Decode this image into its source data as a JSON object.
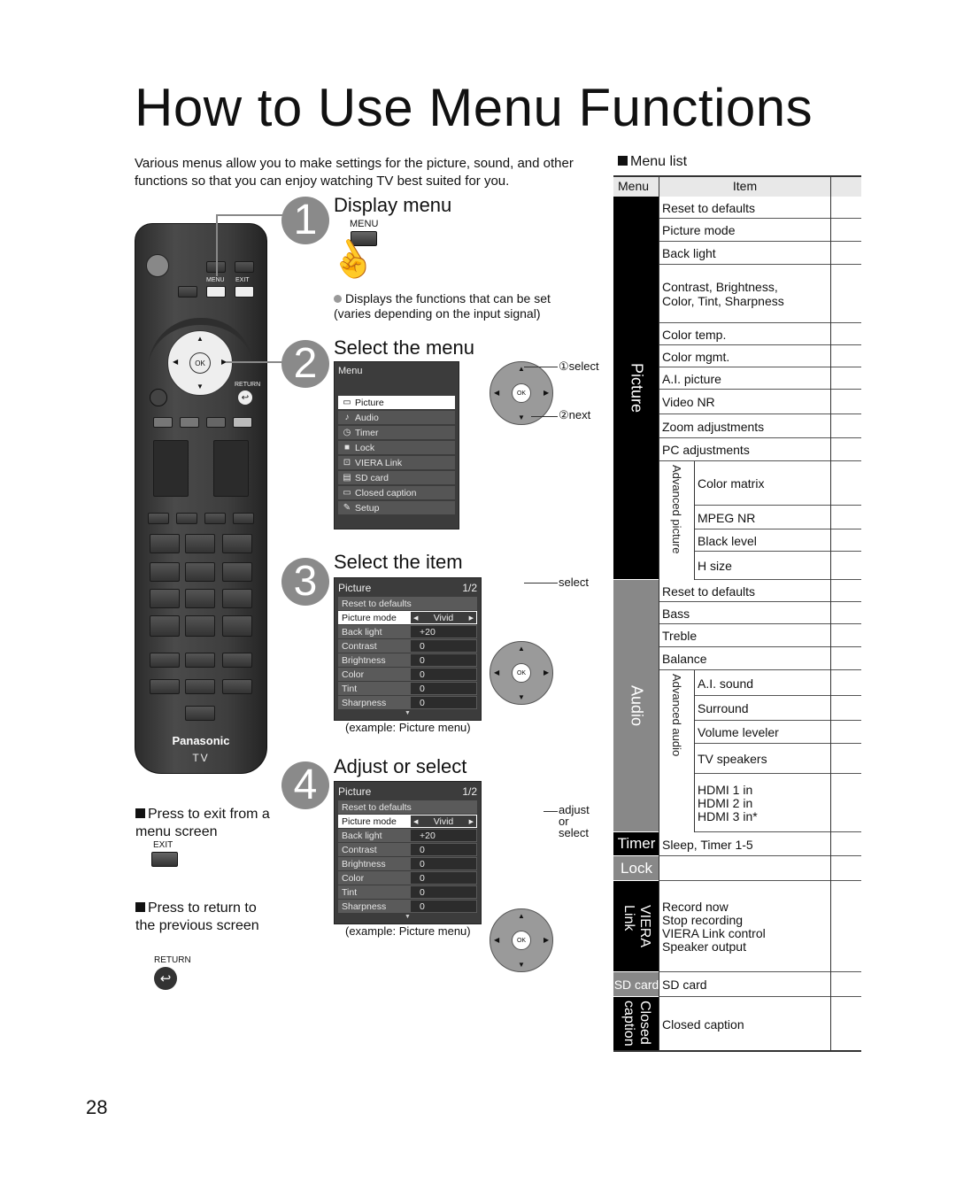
{
  "page": {
    "title": "How to Use Menu Functions",
    "intro": "Various menus allow you to make settings for the picture, sound, and other functions so that you can enjoy watching TV best suited for you.",
    "page_number": "28"
  },
  "remote": {
    "brand": "Panasonic",
    "model": "TV",
    "menu_label": "MENU",
    "exit_label": "EXIT",
    "return_label": "RETURN",
    "ok_label": "OK"
  },
  "steps": [
    {
      "number": "1",
      "title": "Display menu",
      "button_label": "MENU",
      "note": "Displays the functions that can be set (varies depending on the input signal)"
    },
    {
      "number": "2",
      "title": "Select the menu",
      "osd_title": "Menu",
      "menu_items": [
        {
          "icon": "picture-icon",
          "glyph": "▭",
          "label": "Picture",
          "selected": true
        },
        {
          "icon": "audio-icon",
          "glyph": "♪",
          "label": "Audio"
        },
        {
          "icon": "timer-icon",
          "glyph": "◷",
          "label": "Timer"
        },
        {
          "icon": "lock-icon",
          "glyph": "■",
          "label": "Lock"
        },
        {
          "icon": "viera-link-icon",
          "glyph": "⊡",
          "label": "VIERA Link"
        },
        {
          "icon": "sd-card-icon",
          "glyph": "▤",
          "label": "SD card"
        },
        {
          "icon": "closed-caption-icon",
          "glyph": "▭",
          "label": "Closed caption"
        },
        {
          "icon": "setup-icon",
          "glyph": "✎",
          "label": "Setup"
        }
      ],
      "callout_1": "①select",
      "callout_2": "②next"
    },
    {
      "number": "3",
      "title": "Select the item",
      "callout": "select",
      "caption": "(example:  Picture menu)"
    },
    {
      "number": "4",
      "title": "Adjust or select",
      "callout": "adjust\nor\nselect",
      "callout_lines": [
        "adjust",
        "or",
        "select"
      ],
      "caption": "(example:  Picture menu)"
    }
  ],
  "picture_osd": {
    "title": "Picture",
    "page": "1/2",
    "rows": [
      {
        "label": "Reset to defaults",
        "value": ""
      },
      {
        "label": "Picture mode",
        "value": "Vivid",
        "selected": true
      },
      {
        "label": "Back light",
        "value": "+20"
      },
      {
        "label": "Contrast",
        "value": "0"
      },
      {
        "label": "Brightness",
        "value": "0"
      },
      {
        "label": "Color",
        "value": "0"
      },
      {
        "label": "Tint",
        "value": "0"
      },
      {
        "label": "Sharpness",
        "value": "0"
      }
    ]
  },
  "notes": {
    "exit_note": "Press to exit from a menu screen",
    "exit_button": "EXIT",
    "return_note": "Press to return to the previous screen",
    "return_button": "RETURN"
  },
  "menu_list": {
    "heading": "Menu list",
    "col_menu": "Menu",
    "col_item": "Item",
    "categories": [
      {
        "name": "Picture",
        "style": "black"
      },
      {
        "name": "Audio",
        "style": "gray"
      },
      {
        "name": "Timer",
        "style": "black"
      },
      {
        "name": "Lock",
        "style": "gray"
      },
      {
        "name": "VIERA Link",
        "style": "black"
      },
      {
        "name": "SD card",
        "style": "gray"
      },
      {
        "name": "Closed caption",
        "style": "black"
      }
    ],
    "subgroups": [
      {
        "name": "Advanced picture",
        "category": "Picture"
      },
      {
        "name": "Advanced audio",
        "category": "Audio"
      }
    ],
    "rows": [
      {
        "category": "Picture",
        "item": "Reset to defaults"
      },
      {
        "category": "Picture",
        "item": "Picture mode"
      },
      {
        "category": "Picture",
        "item": "Back light"
      },
      {
        "category": "Picture",
        "item": "Contrast, Brightness,\nColor, Tint, Sharpness"
      },
      {
        "category": "Picture",
        "item": "Color temp."
      },
      {
        "category": "Picture",
        "item": "Color mgmt."
      },
      {
        "category": "Picture",
        "item": "A.I. picture"
      },
      {
        "category": "Picture",
        "item": "Video NR"
      },
      {
        "category": "Picture",
        "item": "Zoom adjustments"
      },
      {
        "category": "Picture",
        "item": "PC adjustments"
      },
      {
        "category": "Picture",
        "subgroup": "Advanced picture",
        "item": "Color matrix"
      },
      {
        "category": "Picture",
        "subgroup": "Advanced picture",
        "item": "MPEG NR"
      },
      {
        "category": "Picture",
        "subgroup": "Advanced picture",
        "item": "Black level"
      },
      {
        "category": "Picture",
        "subgroup": "Advanced picture",
        "item": "H size"
      },
      {
        "category": "Audio",
        "item": "Reset to defaults"
      },
      {
        "category": "Audio",
        "item": "Bass"
      },
      {
        "category": "Audio",
        "item": "Treble"
      },
      {
        "category": "Audio",
        "item": "Balance"
      },
      {
        "category": "Audio",
        "subgroup": "Advanced audio",
        "item": "A.I. sound"
      },
      {
        "category": "Audio",
        "subgroup": "Advanced audio",
        "item": "Surround"
      },
      {
        "category": "Audio",
        "subgroup": "Advanced audio",
        "item": "Volume leveler"
      },
      {
        "category": "Audio",
        "subgroup": "Advanced audio",
        "item": "TV speakers"
      },
      {
        "category": "Audio",
        "subgroup": "Advanced audio",
        "item": "HDMI 1 in\nHDMI 2 in\nHDMI 3 in*"
      },
      {
        "category": "Timer",
        "item": "Sleep, Timer 1-5"
      },
      {
        "category": "Lock",
        "item": ""
      },
      {
        "category": "VIERA Link",
        "item": "Record now\nStop recording\nVIERA Link control\nSpeaker output"
      },
      {
        "category": "SD card",
        "item": "SD card"
      },
      {
        "category": "Closed caption",
        "item": "Closed caption"
      }
    ]
  }
}
